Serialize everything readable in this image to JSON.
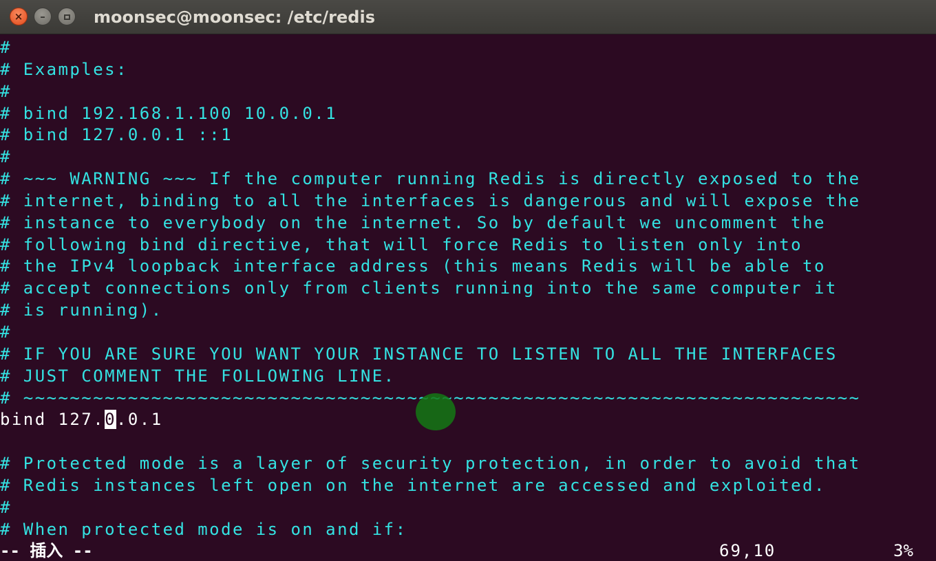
{
  "window": {
    "title": "moonsec@moonsec: /etc/redis",
    "close_glyph": "×",
    "minimize_glyph": "–"
  },
  "editor": {
    "lines": [
      "#",
      "# Examples:",
      "#",
      "# bind 192.168.1.100 10.0.0.1",
      "# bind 127.0.0.1 ::1",
      "#",
      "# ~~~ WARNING ~~~ If the computer running Redis is directly exposed to the",
      "# internet, binding to all the interfaces is dangerous and will expose the",
      "# instance to everybody on the internet. So by default we uncomment the",
      "# following bind directive, that will force Redis to listen only into",
      "# the IPv4 loopback interface address (this means Redis will be able to",
      "# accept connections only from clients running into the same computer it",
      "# is running).",
      "#",
      "# IF YOU ARE SURE YOU WANT YOUR INSTANCE TO LISTEN TO ALL THE INTERFACES",
      "# JUST COMMENT THE FOLLOWING LINE.",
      "# ~~~~~~~~~~~~~~~~~~~~~~~~~~~~~~~~~~~~~~~~~~~~~~~~~~~~~~~~~~~~~~~~~~~~~~~~"
    ],
    "code_line": {
      "before_cursor": "bind 127.",
      "cursor_char": "0",
      "after_cursor": ".0.1"
    },
    "lines_after": [
      "",
      "# Protected mode is a layer of security protection, in order to avoid that",
      "# Redis instances left open on the internet are accessed and exploited.",
      "#",
      "# When protected mode is on and if:"
    ]
  },
  "status": {
    "mode": "-- 插入 --",
    "position": "69,10",
    "percent": "3%"
  },
  "colors": {
    "background": "#2c0a22",
    "comment": "#34e2e2",
    "code": "#ffffff",
    "titlebar": "#3b3a36"
  }
}
